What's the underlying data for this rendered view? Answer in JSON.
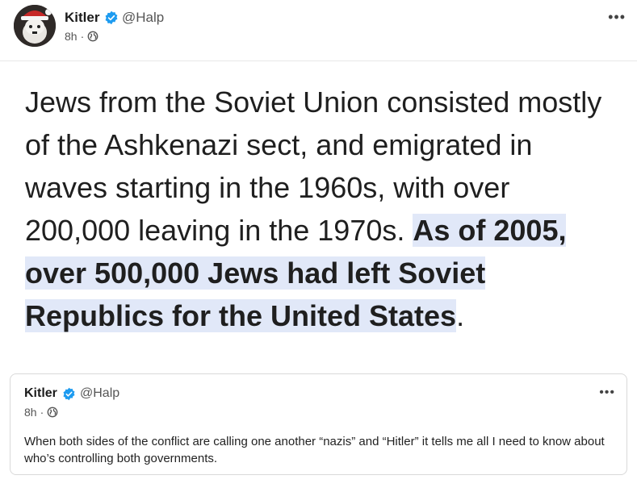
{
  "post": {
    "author": "Kitler",
    "handle": "@Halp",
    "time": "8h",
    "meta_sep": "·",
    "more_label": "•••",
    "text_plain": "Jews from the Soviet Union consisted mostly of the Ashkenazi sect, and emigrated in waves starting in the 1960s, with over 200,000 leaving in the 1970s. ",
    "text_highlight": "As of 2005, over 500,000 Jews had left Soviet Republics for the United States",
    "text_end": "."
  },
  "quoted": {
    "author": "Kitler",
    "handle": "@Halp",
    "time": "8h",
    "meta_sep": "·",
    "more_label": "•••",
    "text": "When both sides of the conflict are calling one another “nazis” and “Hitler” it tells me all I need to know about who’s controlling both governments."
  },
  "icons": {
    "verified": "verified-badge-icon",
    "globe": "globe-icon",
    "more": "more-options-icon",
    "avatar": "avatar-image"
  },
  "colors": {
    "verified": "#1d9bf0",
    "highlight": "#e1e8f8"
  }
}
